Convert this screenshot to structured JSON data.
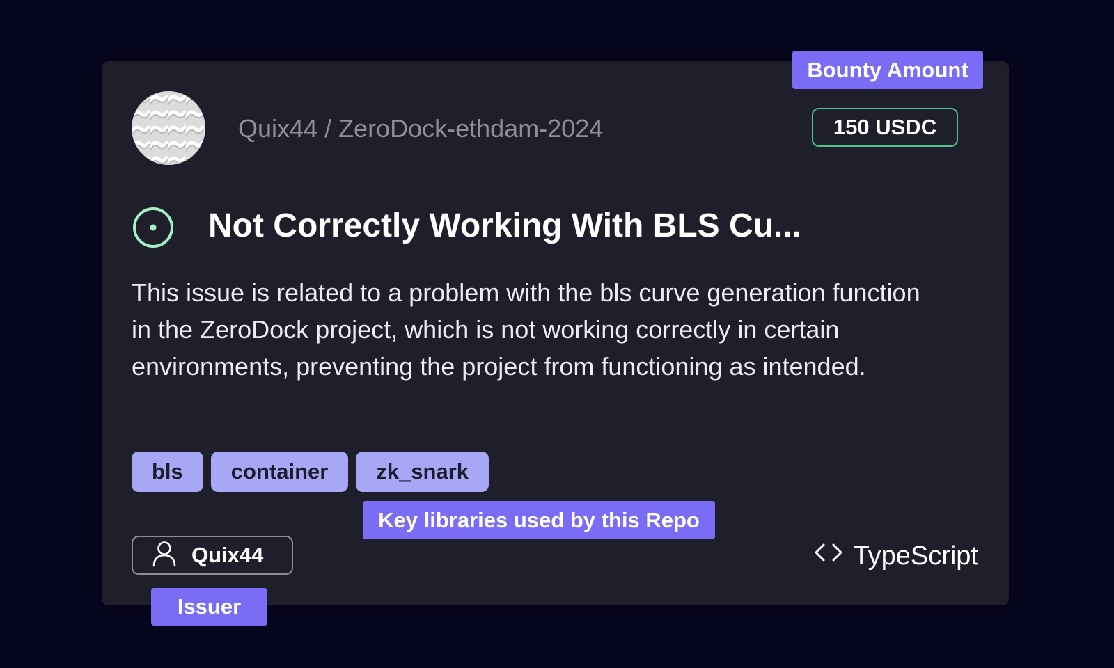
{
  "repo": {
    "owner": "Quix44",
    "separator": "/",
    "name": "ZeroDock-ethdam-2024",
    "path": "Quix44 / ZeroDock-ethdam-2024",
    "avatar_icon": "repo-avatar-pattern"
  },
  "bounty": {
    "callout_label": "Bounty Amount",
    "amount": "150 USDC",
    "border_color": "#4fc28e"
  },
  "issue": {
    "status_icon": "open-issue-icon",
    "status_color": "#a7f0c4",
    "title": "Not Correctly Working With BLS Cu...",
    "description": "This issue is related to a problem with the bls curve generation function in the ZeroDock project, which is not working correctly in certain environments, preventing the project from functioning as intended."
  },
  "tags": {
    "items": [
      "bls",
      "container",
      "zk_snark"
    ],
    "callout_label": "Key libraries used by this Repo",
    "color": "#a8a7f6"
  },
  "issuer": {
    "icon": "user-icon",
    "name": "Quix44",
    "callout_label": "Issuer"
  },
  "language": {
    "icon": "code-brackets-icon",
    "name": "TypeScript"
  },
  "colors": {
    "background": "#07061f",
    "card": "#1f1f2c",
    "callout": "#7b6cf6"
  }
}
